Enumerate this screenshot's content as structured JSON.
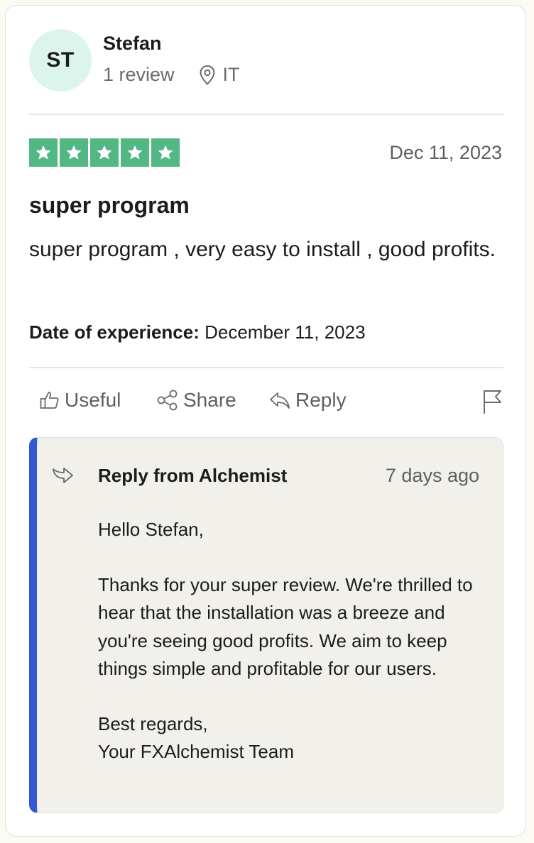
{
  "reviewer": {
    "initials": "ST",
    "name": "Stefan",
    "review_count": "1 review",
    "location_icon": "map-pin-icon",
    "country": "IT"
  },
  "review": {
    "rating": 5,
    "rating_max": 5,
    "star_color": "#53b783",
    "date": "Dec 11, 2023",
    "title": "super program",
    "text": "super program , very easy to install , good profits.",
    "experience_label": "Date of experience:",
    "experience_date": "December 11, 2023"
  },
  "actions": {
    "useful": "Useful",
    "share": "Share",
    "reply": "Reply",
    "report_icon": "flag-icon"
  },
  "reply": {
    "accent_color": "#3358d4",
    "from": "Reply from Alchemist",
    "date": "7 days ago",
    "greeting": "Hello Stefan,",
    "body": "Thanks for your super review. We're thrilled to hear that the installation was a breeze and you're seeing good profits. We aim to keep things simple and profitable for our users.",
    "signoff": "Best regards,",
    "signature": "Your FXAlchemist Team"
  }
}
